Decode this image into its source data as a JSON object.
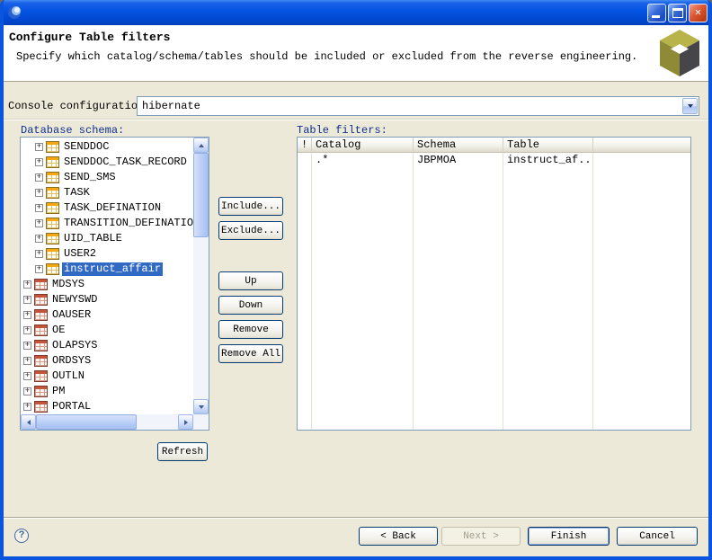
{
  "window": {
    "title": ""
  },
  "icons": {
    "close": "✕",
    "help": "?",
    "expander_collapsed": "+"
  },
  "header": {
    "title": "Configure Table filters",
    "description": "Specify which catalog/schema/tables should be included or excluded from the reverse engineering."
  },
  "console": {
    "label": "Console configuration:",
    "value": "hibernate"
  },
  "schema_panel": {
    "label": "Database schema:",
    "tree": [
      {
        "label": "SENDDOC",
        "type": "table",
        "level": 2
      },
      {
        "label": "SENDDOC_TASK_RECORD",
        "type": "table",
        "level": 2
      },
      {
        "label": "SEND_SMS",
        "type": "table",
        "level": 2
      },
      {
        "label": "TASK",
        "type": "table",
        "level": 2
      },
      {
        "label": "TASK_DEFINATION",
        "type": "table",
        "level": 2
      },
      {
        "label": "TRANSITION_DEFINATION",
        "type": "table",
        "level": 2
      },
      {
        "label": "UID_TABLE",
        "type": "table",
        "level": 2
      },
      {
        "label": "USER2",
        "type": "table",
        "level": 2
      },
      {
        "label": "instruct_affair",
        "type": "table",
        "level": 2,
        "selected": true
      },
      {
        "label": "MDSYS",
        "type": "schema",
        "level": 1
      },
      {
        "label": "NEWYSWD",
        "type": "schema",
        "level": 1
      },
      {
        "label": "OAUSER",
        "type": "schema",
        "level": 1
      },
      {
        "label": "OE",
        "type": "schema",
        "level": 1
      },
      {
        "label": "OLAPSYS",
        "type": "schema",
        "level": 1
      },
      {
        "label": "ORDSYS",
        "type": "schema",
        "level": 1
      },
      {
        "label": "OUTLN",
        "type": "schema",
        "level": 1
      },
      {
        "label": "PM",
        "type": "schema",
        "level": 1
      },
      {
        "label": "PORTAL",
        "type": "schema",
        "level": 1
      }
    ]
  },
  "actions": {
    "include": "Include...",
    "exclude": "Exclude...",
    "up": "Up",
    "down": "Down",
    "remove": "Remove",
    "remove_all": "Remove All",
    "refresh": "Refresh"
  },
  "filters_panel": {
    "label": "Table filters:",
    "columns": [
      "!",
      "Catalog",
      "Schema",
      "Table"
    ],
    "rows": [
      [
        "",
        ".*",
        "JBPMOA",
        "instruct_af..."
      ]
    ]
  },
  "footer": {
    "back": "< Back",
    "next": "Next >",
    "finish": "Finish",
    "cancel": "Cancel"
  }
}
